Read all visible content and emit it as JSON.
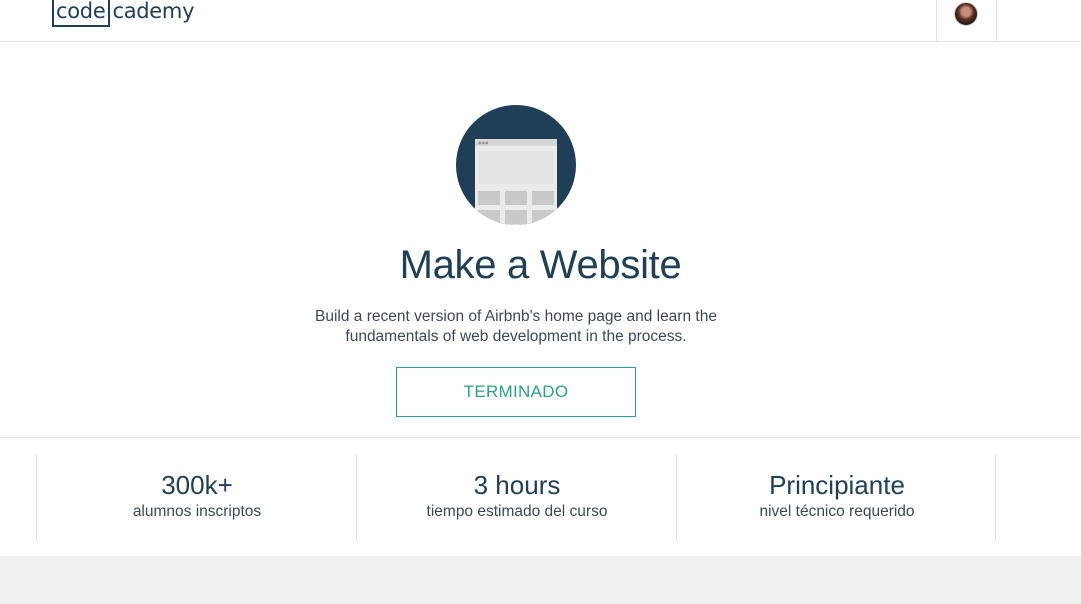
{
  "header": {
    "logo_part1": "code",
    "logo_part2": "cademy",
    "avatar_alt": "user-avatar"
  },
  "course": {
    "icon": "website-browser-icon",
    "title": "Make a Website",
    "description": "Build a recent version of Airbnb's home page and learn the fundamentals of web development in the process.",
    "status_button": "TERMINADO"
  },
  "stats": [
    {
      "value": "300k+",
      "label": "alumnos inscriptos"
    },
    {
      "value": "3 hours",
      "label": "tiempo estimado del curso"
    },
    {
      "value": "Principiante",
      "label": "nivel técnico requerido"
    }
  ],
  "colors": {
    "brand_navy": "#204056",
    "accent_green": "#2aa18a",
    "icon_bg": "#1e3f56",
    "footer_bg": "#f0f2f1"
  }
}
